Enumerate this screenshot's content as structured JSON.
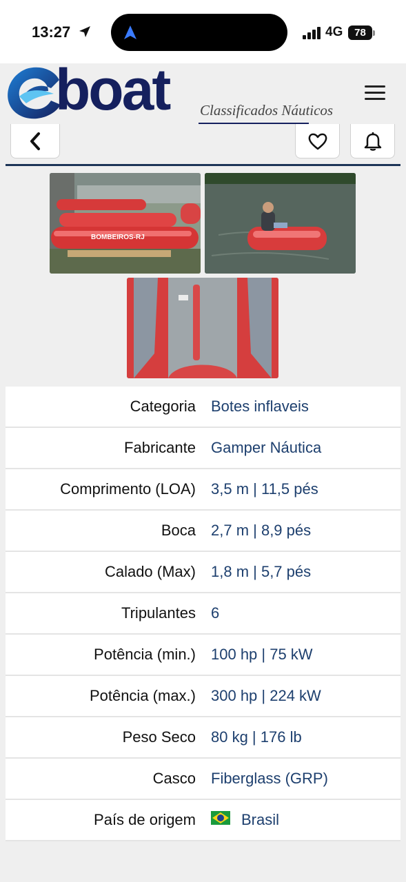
{
  "status_bar": {
    "time": "13:27",
    "network": "4G",
    "battery": "78"
  },
  "header": {
    "logo_text": "boat",
    "tagline": "Classificados Náuticos",
    "brand_color": "#15205e"
  },
  "toolbar": {
    "back_icon": "chevron-left-icon",
    "favorite_icon": "heart-icon",
    "alert_icon": "bell-icon"
  },
  "gallery": {
    "photos": [
      {
        "subject": "red-inflatable-boats-on-trailer",
        "caption": "BOMBEIROS-RJ"
      },
      {
        "subject": "man-driving-inflatable-boat-on-water"
      },
      {
        "subject": "inflatable-boat-interior-floor"
      }
    ]
  },
  "details": [
    {
      "label": "Categoria",
      "value": "Botes inflaveis"
    },
    {
      "label": "Fabricante",
      "value": "Gamper Náutica"
    },
    {
      "label": "Comprimento (LOA)",
      "value": "3,5 m | 11,5 pés"
    },
    {
      "label": "Boca",
      "value": "2,7 m | 8,9 pés"
    },
    {
      "label": "Calado (Max)",
      "value": "1,8 m | 5,7 pés"
    },
    {
      "label": "Tripulantes",
      "value": "6"
    },
    {
      "label": "Potência (min.)",
      "value": "100 hp | 75 kW"
    },
    {
      "label": "Potência (max.)",
      "value": "300 hp | 224 kW"
    },
    {
      "label": "Peso Seco",
      "value": "80 kg | 176 lb"
    },
    {
      "label": "Casco",
      "value": "Fiberglass (GRP)"
    },
    {
      "label": "País de origem",
      "value": "Brasil",
      "flag": "brazil-flag-icon"
    }
  ]
}
